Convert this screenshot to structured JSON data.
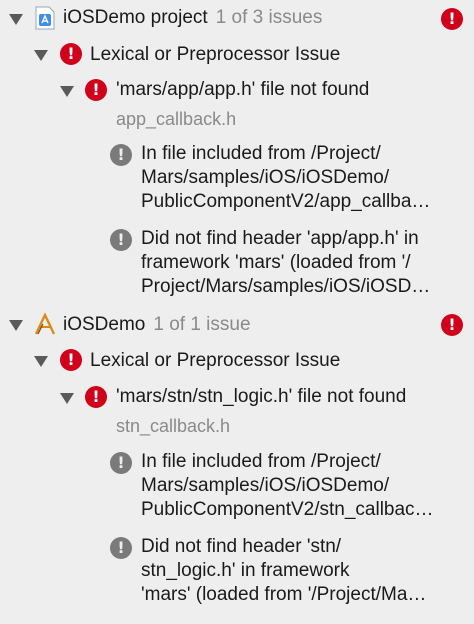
{
  "issues": [
    {
      "project": "iOSDemo project",
      "count": "1 of 3 issues",
      "icon": "app-project-icon",
      "group": "Lexical or Preprocessor Issue",
      "error": "'mars/app/app.h' file not found",
      "file": "app_callback.h",
      "note1": [
        "In file included from /Project/",
        "Mars/samples/iOS/iOSDemo/",
        "PublicComponentV2/app_callba…"
      ],
      "note2": [
        "Did not find header 'app/app.h' in",
        "framework 'mars' (loaded from '/",
        "Project/Mars/samples/iOS/iOSD…"
      ]
    },
    {
      "project": "iOSDemo",
      "count": "1 of 1 issue",
      "icon": "xcode-target-icon",
      "group": "Lexical or Preprocessor Issue",
      "error": "'mars/stn/stn_logic.h' file not found",
      "file": "stn_callback.h",
      "note1": [
        "In file included from /Project/",
        "Mars/samples/iOS/iOSDemo/",
        "PublicComponentV2/stn_callbac…"
      ],
      "note2": [
        "Did not find header 'stn/",
        "stn_logic.h' in framework",
        "'mars' (loaded from '/Project/Ma…"
      ]
    }
  ],
  "colors": {
    "error": "#d0021b",
    "note": "#7a7a7a",
    "background": "#eeeeee"
  }
}
